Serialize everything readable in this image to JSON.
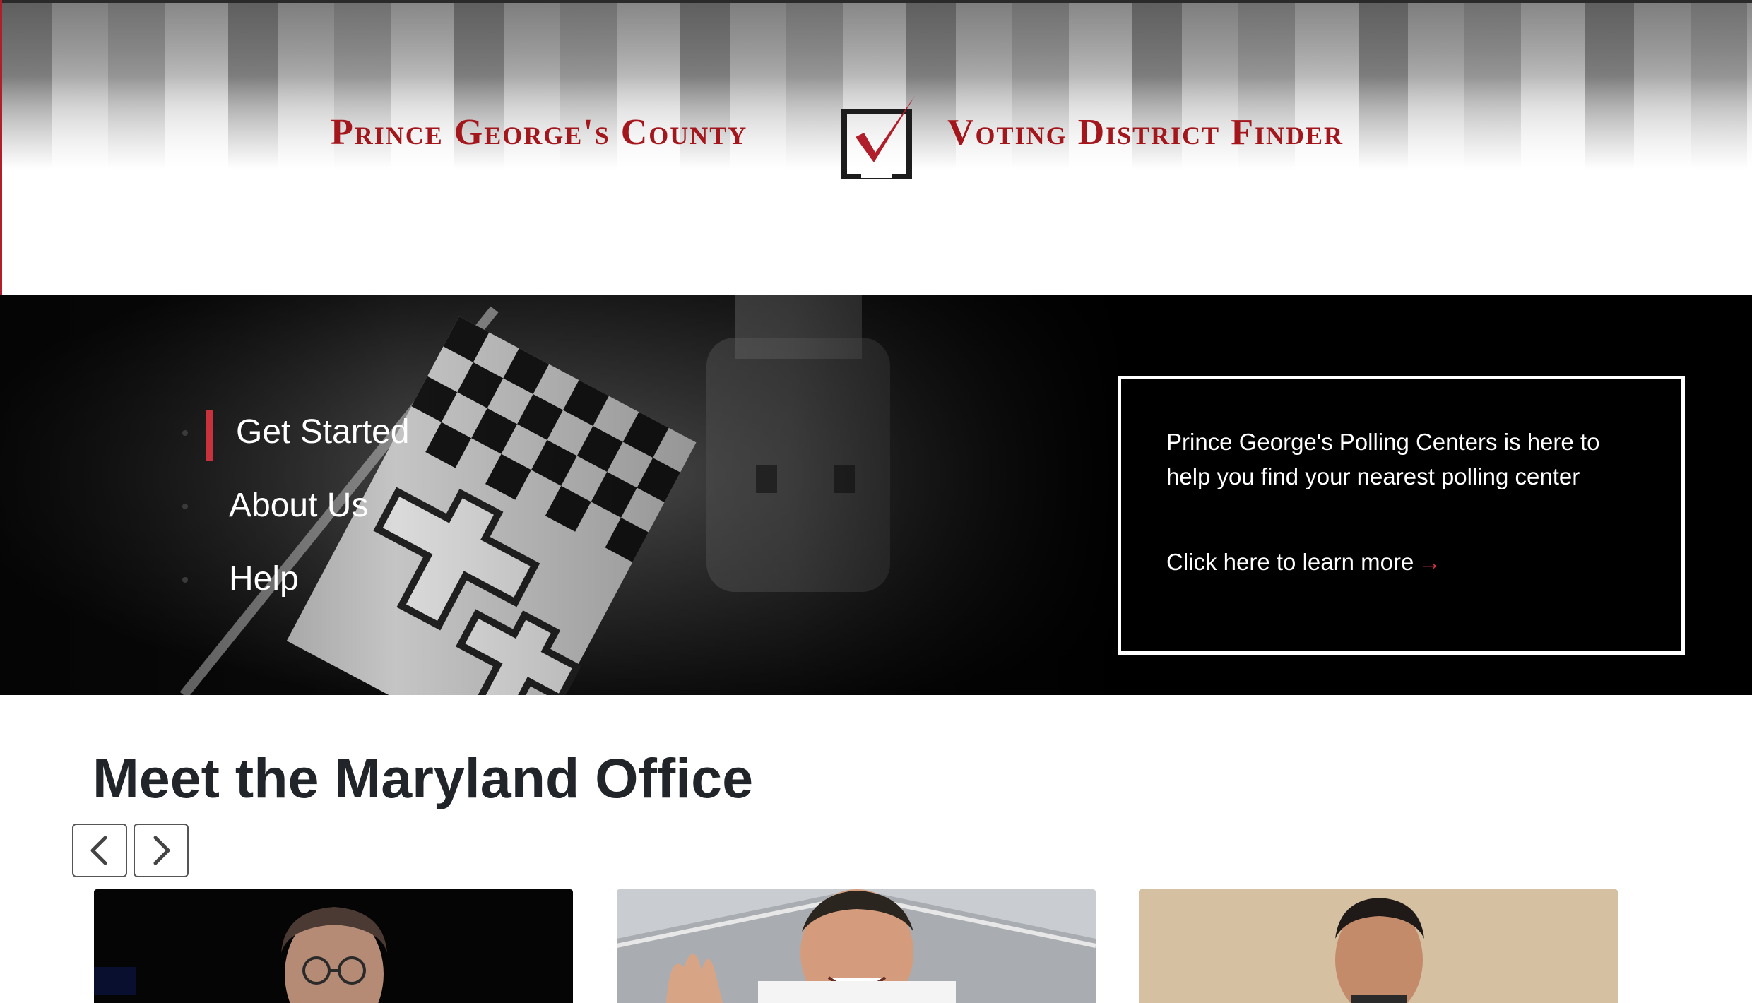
{
  "header": {
    "title_left": "Prince George's County",
    "title_right": "Voting District Finder",
    "brand_color": "#a3161c",
    "logo_icon": "checkbox-check-icon"
  },
  "hero": {
    "nav": [
      {
        "label": "Get Started",
        "active": true
      },
      {
        "label": "About Us",
        "active": false
      },
      {
        "label": "Help",
        "active": false
      }
    ],
    "info": {
      "text": "Prince George's Polling Centers is here to help you find your nearest polling center",
      "link_label": "Click here to learn more",
      "link_icon": "arrow-right-icon",
      "accent": "#d0353f"
    }
  },
  "meet": {
    "title": "Meet the Maryland Office",
    "prev_icon": "chevron-left-icon",
    "next_icon": "chevron-right-icon"
  }
}
